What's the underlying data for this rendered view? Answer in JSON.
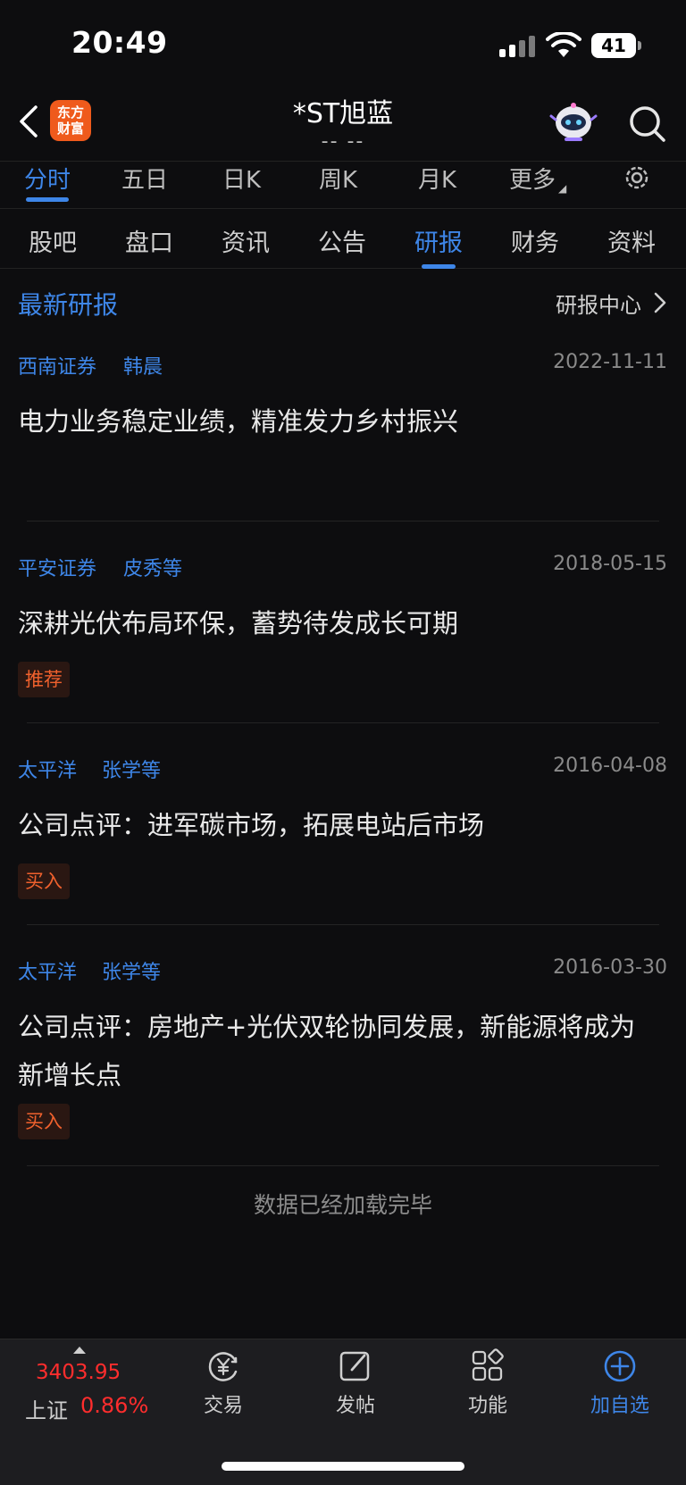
{
  "status_bar": {
    "time": "20:49",
    "battery": "41"
  },
  "header": {
    "title": "*ST旭蓝",
    "subtitle": "-- --",
    "logo_text_1": "东方",
    "logo_text_2": "财富"
  },
  "chart_tabs": [
    "分时",
    "五日",
    "日K",
    "周K",
    "月K",
    "更多"
  ],
  "info_tabs": [
    "股吧",
    "盘口",
    "资讯",
    "公告",
    "研报",
    "财务",
    "资料"
  ],
  "section": {
    "title": "最新研报",
    "center_link": "研报中心"
  },
  "reports": [
    {
      "broker": "西南证券",
      "author": "韩晨",
      "date": "2022-11-11",
      "headline": "电力业务稳定业绩，精准发力乡村振兴",
      "rating": ""
    },
    {
      "broker": "平安证券",
      "author": "皮秀等",
      "date": "2018-05-15",
      "headline": "深耕光伏布局环保，蓄势待发成长可期",
      "rating": "推荐"
    },
    {
      "broker": "太平洋",
      "author": "张学等",
      "date": "2016-04-08",
      "headline": "公司点评：进军碳市场，拓展电站后市场",
      "rating": "买入"
    },
    {
      "broker": "太平洋",
      "author": "张学等",
      "date": "2016-03-30",
      "headline": "公司点评：房地产+光伏双轮协同发展，新能源将成为新增长点",
      "rating": "买入"
    }
  ],
  "footer_note": "数据已经加载完毕",
  "bottom_bar": {
    "index_value": "3403.95",
    "index_name": "上证",
    "index_change": "0.86%",
    "items": [
      "交易",
      "发帖",
      "功能",
      "加自选"
    ]
  },
  "colors": {
    "accent": "#3e86e8",
    "up": "#ff2d2d",
    "rating": "#f0612d",
    "background": "#0d0d0f"
  }
}
